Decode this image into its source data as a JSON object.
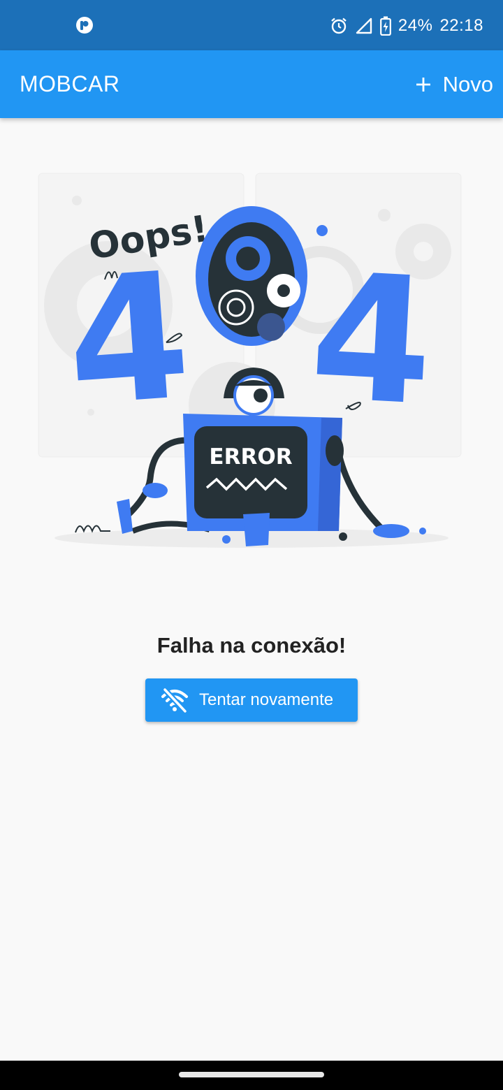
{
  "status_bar": {
    "battery": "24%",
    "time": "22:18",
    "icons": [
      "app-notification-icon",
      "alarm-icon",
      "signal-icon",
      "battery-charging-icon"
    ]
  },
  "app_bar": {
    "title": "MOBCAR",
    "new_label": "Novo",
    "new_icon": "plus-icon"
  },
  "illustration": {
    "headline": "Oops!",
    "digit_left": "4",
    "digit_right": "4",
    "screen_text": "ERROR",
    "accent_color": "#3f7bf2",
    "dark_color": "#263238"
  },
  "error": {
    "message": "Falha na conexão!"
  },
  "retry_button": {
    "label": "Tentar novamente",
    "icon": "wifi-off-icon"
  },
  "colors": {
    "status_bar": "#1c70b8",
    "app_bar": "#2196f3",
    "background": "#f9f9f9"
  }
}
